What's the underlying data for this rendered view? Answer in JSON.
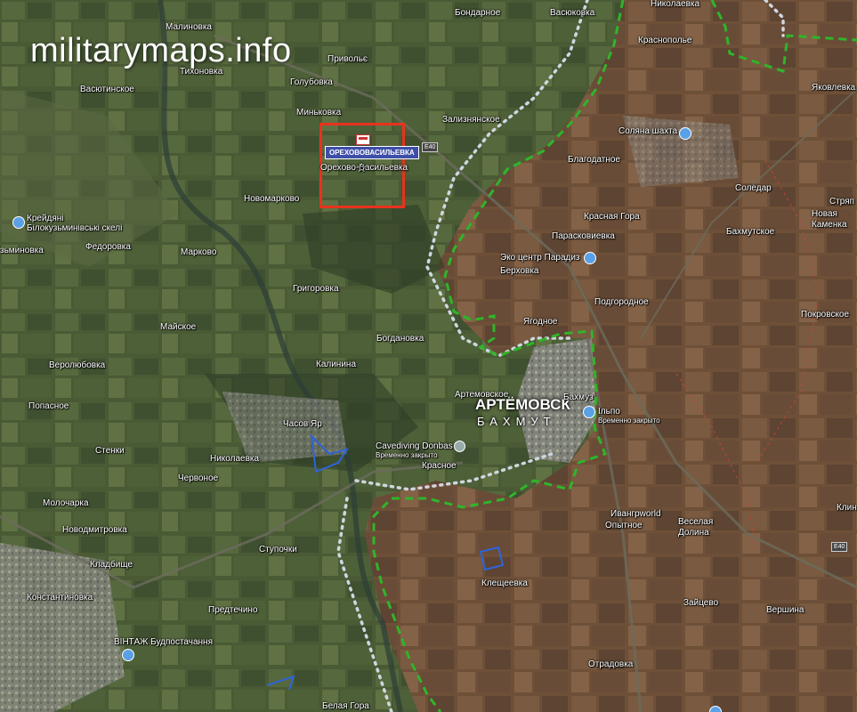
{
  "watermark": "militarymaps.info",
  "highlight": {
    "badge_text": "ОРЕХОВОВАСИЛЬЕВКА",
    "village_label": "Орехово-Васильевка"
  },
  "main_city": {
    "ru": "АРТЁМОВСК",
    "ua": "БАХМУТ"
  },
  "road_shields": [
    "E40",
    "E40"
  ],
  "places": {
    "malinovka": "Малиновка",
    "tikhonovka": "Тихоновка",
    "vasyutinskoe": "Васютинское",
    "privolye": "Привольє",
    "golubovka": "Голубовка",
    "minkovka": "Миньковка",
    "bondarnoe": "Бондарное",
    "vasyukovka": "Васюковка",
    "nikolaevka_top": "Николаевка",
    "krasnopolye": "Краснополье",
    "yakovlevka": "Яковлевка",
    "zaliznyanskoe": "Зализнянское",
    "blagodatnoe": "Благодатное",
    "solyanaya": "Соляна шахта",
    "soledar": "Соледар",
    "strypy": "Стряп",
    "novaya_kamenka_1": "Новая",
    "novaya_kamenka_2": "Каменка",
    "bakhmutskoe": "Бахмутское",
    "novomarkovo": "Новомарково",
    "kreydyani_1": "Крейдяні",
    "kreydyani_2": "Білокузьминівські скелі",
    "kuzminovka": "зьминовка",
    "fedorovka": "Федоровка",
    "markovo": "Марково",
    "krasnaya_gora": "Красная Гора",
    "paraskovievka": "Парасковиевка",
    "eko_centr": "Эко центр Парадиз",
    "berkhovka": "Берховка",
    "grigorovka": "Григоровка",
    "podgorodnoe": "Подгородное",
    "yagodnoe": "Ягодное",
    "pokrovskoe": "Покровское",
    "mayskoe": "Майское",
    "bogdanovka": "Богдановка",
    "verolyubovka": "Веролюбовка",
    "kalinina": "Калинина",
    "popasnoe": "Попасное",
    "artemovskoe": "Артемовское",
    "bakhmuz": "Бахмуз",
    "chasov_yar": "Часов Яр",
    "sldpo": "Ільпо",
    "vremenno_zakryto": "Временно закрыто",
    "cavediving": "Cavediving Donbas",
    "vremenno_zakryto2": "Временно закрыто",
    "stenki": "Стенки",
    "nikolaevka": "Николаевка",
    "krasnoe": "Красное",
    "chervonoe": "Червоное",
    "ivangrad": "Ивангрworld",
    "opytnoe": "Опытное",
    "veselaya_1": "Веселая",
    "veselaya_2": "Долина",
    "molochaarka": "Молочарка",
    "novodmitrovka": "Новодмитровка",
    "stupochki": "Ступочки",
    "kladbishche": "Кладбище",
    "kleshcheevka": "Клещеевка",
    "zaytsevo": "Зайцево",
    "vershina": "Вершина",
    "konstantinovka": "Константиновка",
    "predtechino": "Предтечино",
    "vintazh": "ВІНТАЖ Будпостачання",
    "otradovka": "Отрадовка",
    "belaya_gora": "Белая Гора",
    "klin": "Клин"
  },
  "colors": {
    "front_line": "#2fb52a",
    "gray_zone": "#cfd6e0",
    "highlight": "#e8321e",
    "poi": "#5aa0e6"
  }
}
